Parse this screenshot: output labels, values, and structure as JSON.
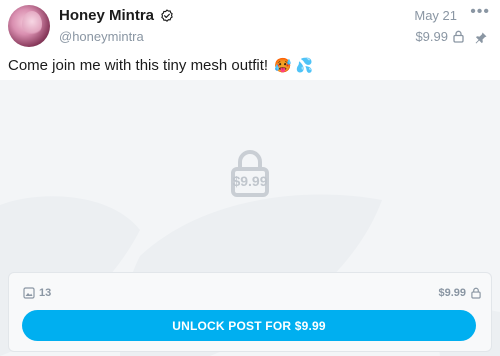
{
  "post": {
    "author_name": "Honey Mintra",
    "author_handle": "@honeymintra",
    "date": "May 21",
    "more_label": "•••",
    "price": "$9.99",
    "caption": "Come join me with this tiny mesh outfit!",
    "caption_emojis": "🥵 💦"
  },
  "media": {
    "locked_price": "$9.99",
    "media_count": "13",
    "panel_price": "$9.99",
    "unlock_label": "UNLOCK POST FOR $9.99"
  },
  "icons": {
    "verified": "verified-check-icon",
    "lock": "lock-icon",
    "pin": "pin-icon",
    "image": "image-icon"
  },
  "colors": {
    "accent": "#00aff0",
    "muted": "#8a96a3",
    "media_bg": "#f3f5f7"
  }
}
